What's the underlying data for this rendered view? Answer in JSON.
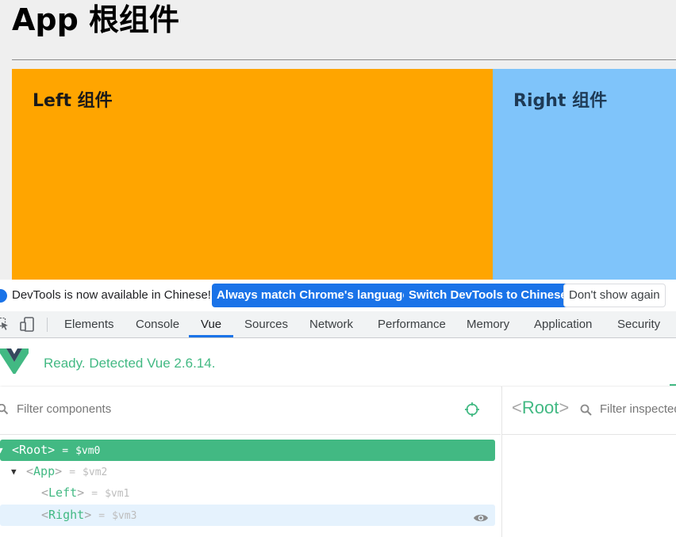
{
  "page": {
    "title": "App 根组件",
    "left_title": "Left 组件",
    "right_title": "Right 组件",
    "colors": {
      "left_bg": "#ffa500",
      "right_bg": "#7fc4fa",
      "page_bg": "#efefef"
    }
  },
  "devtools": {
    "infobar": {
      "message": "DevTools is now available in Chinese!",
      "buttons": {
        "match_language": "Always match Chrome's language",
        "switch_chinese": "Switch DevTools to Chinese",
        "dont_show": "Don't show again"
      }
    },
    "toolbar": {
      "icons": [
        "inspect-element-icon",
        "device-toolbar-icon"
      ],
      "tabs": [
        "Elements",
        "Console",
        "Vue",
        "Sources",
        "Network",
        "Performance",
        "Memory",
        "Application",
        "Security"
      ],
      "active_tab": "Vue",
      "accent": "#1a73e8"
    },
    "vue": {
      "status": "Ready. Detected Vue 2.6.14.",
      "accent": "#42b983",
      "filter_placeholder": "Filter components",
      "tree": [
        {
          "name": "Root",
          "vm": "$vm0",
          "selected": true,
          "expanded": true
        },
        {
          "name": "App",
          "vm": "$vm2",
          "expanded": true
        },
        {
          "name": "Left",
          "vm": "$vm1"
        },
        {
          "name": "Right",
          "vm": "$vm3",
          "hovered": true
        }
      ],
      "inspector": {
        "root_label": "Root",
        "filter_placeholder": "Filter inspected data"
      }
    }
  }
}
